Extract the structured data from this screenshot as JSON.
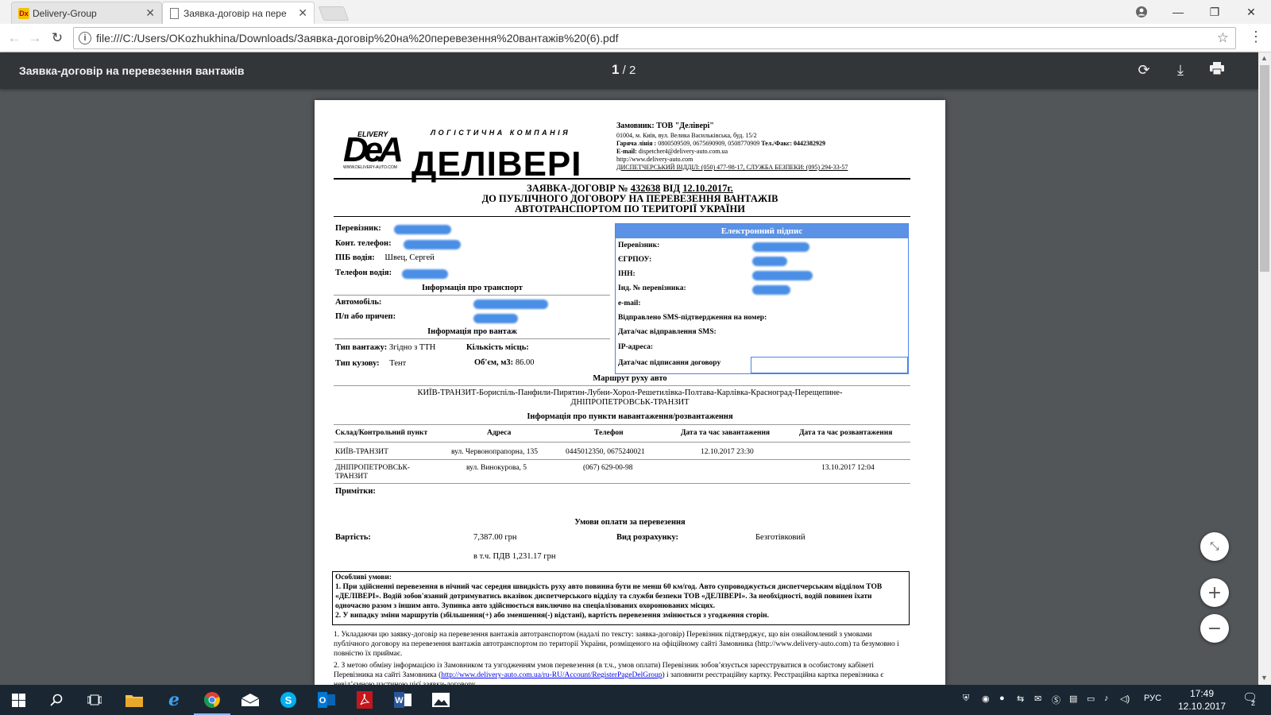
{
  "browser": {
    "tabs": [
      {
        "title": "Delivery-Group",
        "icon": "dg-favicon"
      },
      {
        "title": "Заявка-договір на пере",
        "icon": "document-icon"
      }
    ],
    "url": "file:///C:/Users/OKozhukhina/Downloads/Заявка-договір%20на%20перевезення%20вантажів%20(6).pdf"
  },
  "pdf": {
    "title": "Заявка-договір на перевезення вантажів",
    "current_page": "1",
    "total_pages": "/ 2"
  },
  "doc": {
    "logo_left_small": "ELIVERY",
    "logo_left_big": "DeA",
    "logo_left_url": "WWW.DELIVERY-AUTO.COM",
    "logo_sub": "ЛОГІСТИЧНА КОМПАНІЯ",
    "logo_main": "ДЕЛІВЕРІ",
    "customer": {
      "label": "Замовник:",
      "name": "ТОВ \"Делівері\"",
      "address": "01004, м. Київ, вул. Велика Васильківська, буд. 15/2",
      "hotline_label": "Гаряча лінія :",
      "hotline": "0800509509, 0675690909, 0508770909",
      "fax_label": "Тел./Факс:",
      "fax": "0442382929",
      "email_label": "E-mail:",
      "email": "dispetcher4@delivery-auto.com.ua",
      "site": "http://www.delivery-auto.com",
      "dispatch": "ДИСПЕТЧЕРСЬКИЙ ВІДДІЛ: (050) 477-98-17, СЛУЖБА БЕЗПЕКИ: (095) 294-33-57"
    },
    "heading1_prefix": "ЗАЯВКА-ДОГОВІР №",
    "number": "432638",
    "heading1_mid": "ВІД",
    "date": "12.10.2017г.",
    "heading2": "ДО ПУБЛІЧНОГО ДОГОВОРУ НА ПЕРЕВЕЗЕННЯ ВАНТАЖІВ",
    "heading3": "АВТОТРАНСПОРТОМ ПО ТЕРИТОРІЇ УКРАЇНИ",
    "carrier_label": "Перевізник:",
    "phone_label": "Конт. телефон:",
    "driver_label": "ПІБ водія:",
    "driver_name": "Швец, Сергей",
    "driver_phone_label": "Телефон водія:",
    "transport_header": "Інформація про транспорт",
    "auto_label": "Автомобіль:",
    "trailer_label": "П/п або причеп:",
    "cargo_header": "Інформація про вантаж",
    "cargo_type_label": "Тип вантажу:",
    "cargo_type": "Згідно з ТТН",
    "places_label": "Кількість місць:",
    "body_type_label": "Тип кузову:",
    "body_type": "Тент",
    "volume_label": "Об'єм, м3:",
    "volume": "86.00",
    "esig": {
      "header": "Електронний підпис",
      "rows": [
        "Перевізник:",
        "ЄГРПОУ:",
        "ІНН:",
        "Інд. № перевізника:",
        "e-mail:",
        "Відправлено SMS-підтвердження на номер:",
        "Дата/час відправлення SMS:",
        "IP-адреса:",
        "Дата/час підписання договору"
      ]
    },
    "route_header": "Маршрут руху авто",
    "route_line1": "КИЇВ-ТРАНЗИТ-Бориспіль-Панфили-Пирятин-Лубни-Хорол-Решетилівка-Полтава-Карлівка-Красноград-Перещепине-",
    "route_line2": "ДНІПРОПЕТРОВСЬК-ТРАНЗИТ",
    "points_header": "Інформація про пункти навантаження/розвантаження",
    "points_columns": [
      "Склад/Контрольний пункт",
      "Адреса",
      "Телефон",
      "Дата та час завантаження",
      "Дата та час розвантаження"
    ],
    "points_rows": [
      {
        "point": "КИЇВ-ТРАНЗИТ",
        "address": "вул. Червонопрапорна, 135",
        "phone": "0445012350, 0675240021",
        "load": "12.10.2017 23:30",
        "unload": ""
      },
      {
        "point": "ДНІПРОПЕТРОВСЬК-",
        "point2": "ТРАНЗИТ",
        "address": "вул. Винокурова, 5",
        "phone": "(067) 629-00-98",
        "load": "",
        "unload": "13.10.2017 12:04"
      }
    ],
    "notes_label": "Примітки:",
    "payment_header": "Умови оплати за перевезення",
    "cost_label": "Вартість:",
    "cost": "7,387.00 грн",
    "calc_label": "Вид розрахунку:",
    "calc": "Безготівковий",
    "vat": "в т.ч. ПДВ 1,231.17 грн",
    "special_title": "Особливі умови:",
    "special_1": "1. При здійсненні перевезення в нічний час середня швидкість руху авто повинна бути не менш 60 км/год. Авто супроводжується диспетчерським відділом ТОВ «ДЕЛІВЕРІ». Водій зобов'язаний дотримуватись вказівок диспетчерського відділу та служби безпеки ТОВ «ДЕЛІВЕРІ». За необхідності, водій повинен їхати одночасно разом з іншим авто. Зупинка авто здійснюється виключно на спеціалізованих охоронюваних місцях.",
    "special_2": "2. У випадку зміни маршрутів (збільшення(+) або зменшення(-) відстані), вартість перевезення змінюється з угодження сторін.",
    "para1": "1. Укладаючи цю заявку-договір на перевезення вантажів автотранспортом (надалі по тексту: заявка-договір) Перевізник підтверджує, що він ознайомлений з умовами публічного договору на перевезення вантажів автотранспортом по території України, розміщеного на офіційному сайті Замовника (http://www.delivery-auto.com) та безумовно і повністю їх приймає.",
    "para2_a": "2. З метою обміну інформацією із Замовником та узгодженням умов перевезення (в т.ч., умов оплати) Перевізник зобов’язується зареєструватися в особистому кабінеті Перевізника на сайті Замовника (",
    "para2_link": "http://www.delivery-auto.com.ua/ru-RU/Account/RegisterPageDelGroup",
    "para2_b": ") і заповнити реєстраційну картку. Реєстраційна картка перевізника є невід’ємною частиною цієї заявки-договору."
  },
  "taskbar": {
    "lang": "РУС",
    "time": "17:49",
    "date": "12.10.2017",
    "notifications": "2"
  }
}
